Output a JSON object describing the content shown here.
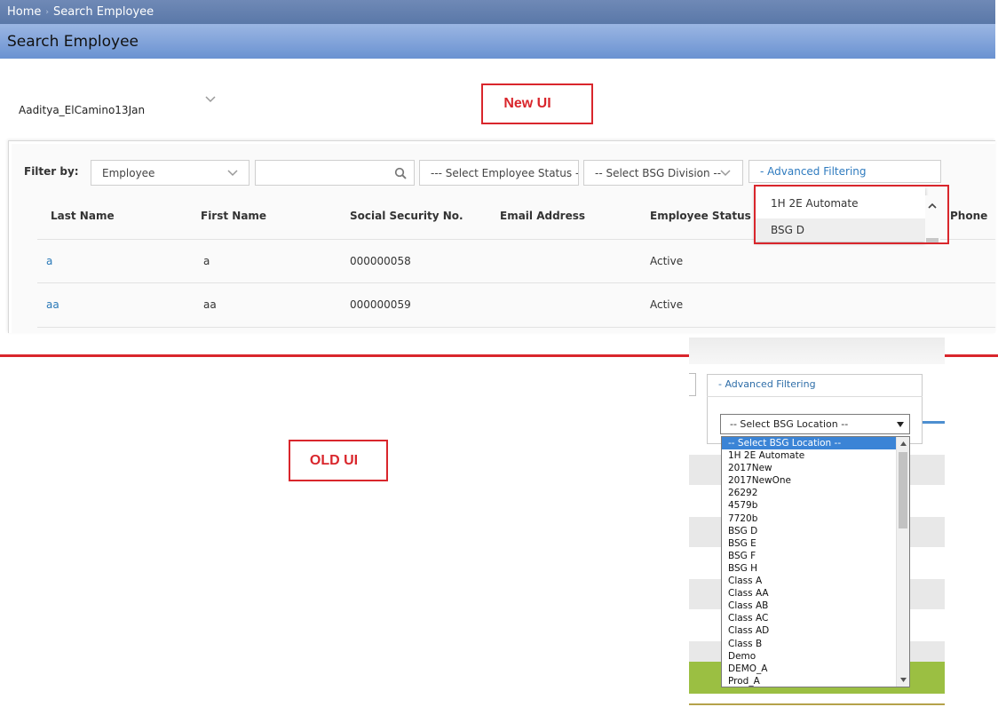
{
  "breadcrumb": {
    "home": "Home",
    "separator": "›",
    "current": "Search Employee"
  },
  "page_title": "Search Employee",
  "account": {
    "name": "Aaditya_ElCamino13Jan"
  },
  "callouts": {
    "new_ui": "New UI",
    "old_ui": "OLD UI"
  },
  "filter": {
    "label": "Filter by:",
    "type_select": "Employee",
    "search_value": "",
    "status_select": "--- Select Employee Status ---",
    "division_select": "-- Select BSG Division --",
    "advanced_toggle": "- Advanced Filtering"
  },
  "table": {
    "headers": {
      "last_name": "Last Name",
      "first_name": "First Name",
      "ssn": "Social Security No.",
      "email": "Email Address",
      "status": "Employee Status",
      "phone": "Phone"
    },
    "rows": [
      {
        "last_name": "a",
        "first_name": "a",
        "ssn": "000000058",
        "email": "",
        "status": "Active"
      },
      {
        "last_name": "aa",
        "first_name": "aa",
        "ssn": "000000059",
        "email": "",
        "status": "Active"
      }
    ]
  },
  "new_dropdown": {
    "options": [
      "1H 2E Automate",
      "BSG D"
    ],
    "highlighted_index": 1
  },
  "old_ui": {
    "advanced_toggle": "- Advanced Filtering",
    "location_select": "-- Select BSG Location --",
    "options": [
      "-- Select BSG Location --",
      "1H 2E Automate",
      "2017New",
      "2017NewOne",
      "26292",
      "4579b",
      "7720b",
      "BSG D",
      "BSG E",
      "BSG F",
      "BSG H",
      "Class A",
      "Class AA",
      "Class AB",
      "Class AC",
      "Class AD",
      "Class B",
      "Demo",
      "DEMO_A",
      "Prod_A"
    ],
    "selected_index": 0
  },
  "colors": {
    "accent_red": "#d9262c",
    "link_blue": "#2a79b8",
    "header_blue": "#6a92d1",
    "old_green": "#9bbf42"
  },
  "icons": {
    "search": "search-icon",
    "chevron": "chevron-down-icon",
    "scroll_up": "arrow-up-icon",
    "scroll_down": "arrow-down-icon"
  }
}
